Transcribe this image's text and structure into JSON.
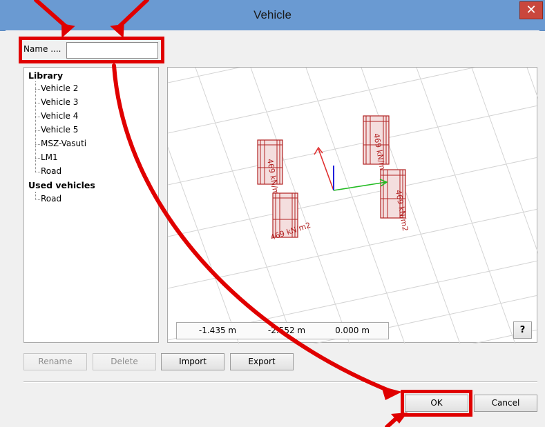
{
  "window": {
    "title": "Vehicle",
    "close_glyph": "✕"
  },
  "name_field": {
    "label": "Name ....",
    "value": ""
  },
  "tree": {
    "library_header": "Library",
    "library_items": [
      "Vehicle 2",
      "Vehicle 3",
      "Vehicle 4",
      "Vehicle 5",
      "MSZ-Vasuti",
      "LM1",
      "Road"
    ],
    "used_header": "Used vehicles",
    "used_items": [
      "Road"
    ]
  },
  "viewport": {
    "load_labels": [
      "469 kN/m2",
      "469 kN/m2",
      "469 kN/m2",
      "469 kN/m2"
    ],
    "coords": {
      "x": "-1.435 m",
      "y": "-2.552 m",
      "z": "0.000 m"
    },
    "help_label": "?"
  },
  "buttons": {
    "rename": "Rename",
    "delete": "Delete",
    "import": "Import",
    "export": "Export",
    "ok": "OK",
    "cancel": "Cancel"
  },
  "colors": {
    "highlight": "#e00000",
    "titlebar": "#6a9ad2",
    "load_box": "#b22222",
    "axis_x": "#22bb22",
    "axis_y": "#e03030",
    "axis_z": "#2020dd"
  }
}
